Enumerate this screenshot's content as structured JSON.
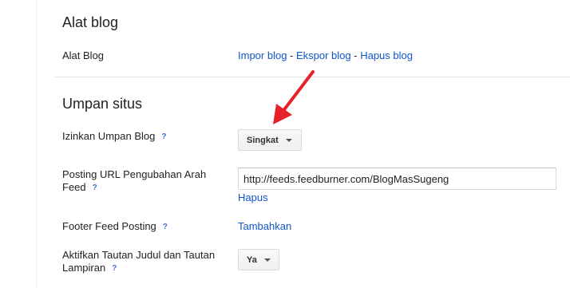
{
  "tools": {
    "title": "Alat blog",
    "label": "Alat Blog",
    "import": "Impor blog",
    "export": "Ekspor blog",
    "delete": "Hapus blog",
    "separator": " - "
  },
  "feed": {
    "title": "Umpan situs",
    "help": "?",
    "allow_feed": {
      "label": "Izinkan Umpan Blog",
      "value": "Singkat"
    },
    "redirect": {
      "label": "Posting URL Pengubahan Arah Feed",
      "value": "http://feeds.feedburner.com/BlogMasSugeng",
      "remove": "Hapus"
    },
    "footer": {
      "label": "Footer Feed Posting",
      "action": "Tambahkan"
    },
    "title_links": {
      "label": "Aktifkan Tautan Judul dan Tautan Lampiran",
      "value": "Ya"
    }
  },
  "colors": {
    "link": "#1155cc",
    "help": "#4273c8",
    "arrow": "#e8202a"
  },
  "icons": {
    "annotation": "red-arrow-icon",
    "dropdown": "caret-down-icon"
  }
}
